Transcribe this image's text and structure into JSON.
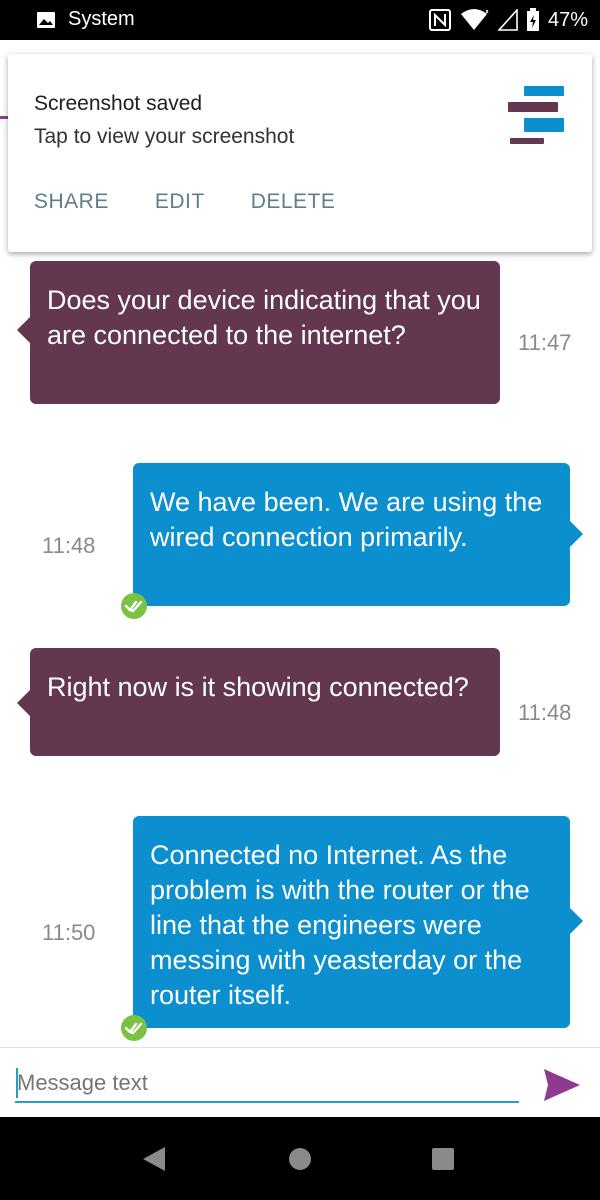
{
  "status_bar": {
    "app_name": "System",
    "battery": "47%"
  },
  "notification": {
    "title": "Screenshot saved",
    "subtitle": "Tap to view your screenshot",
    "actions": [
      "SHARE",
      "EDIT",
      "DELETE"
    ]
  },
  "messages": [
    {
      "direction": "incoming",
      "text": "Does your device indicating that you are connected to the internet?",
      "time": "11:47"
    },
    {
      "direction": "outgoing",
      "text": "We have been. We are using the wired connection primarily.",
      "time": "11:48",
      "delivered": true
    },
    {
      "direction": "incoming",
      "text": "Right now is it showing connected?",
      "time": "11:48"
    },
    {
      "direction": "outgoing",
      "text": "Connected no Internet. As the problem is with the router or the line that the engineers were messing with yeasterday or the router itself.",
      "time": "11:50",
      "delivered": true
    }
  ],
  "composer": {
    "placeholder": "Message text"
  },
  "colors": {
    "incoming_bubble": "#633750",
    "outgoing_bubble": "#0c8fcf",
    "accent": "#8e3a8f",
    "delivered_check": "#7cc242"
  },
  "icons": {
    "status_left": "image-icon",
    "status_right": [
      "nfc-icon",
      "wifi-icon",
      "signal-icon",
      "battery-icon"
    ],
    "send": "send-icon",
    "nav": [
      "back-icon",
      "home-icon",
      "recents-icon"
    ]
  }
}
